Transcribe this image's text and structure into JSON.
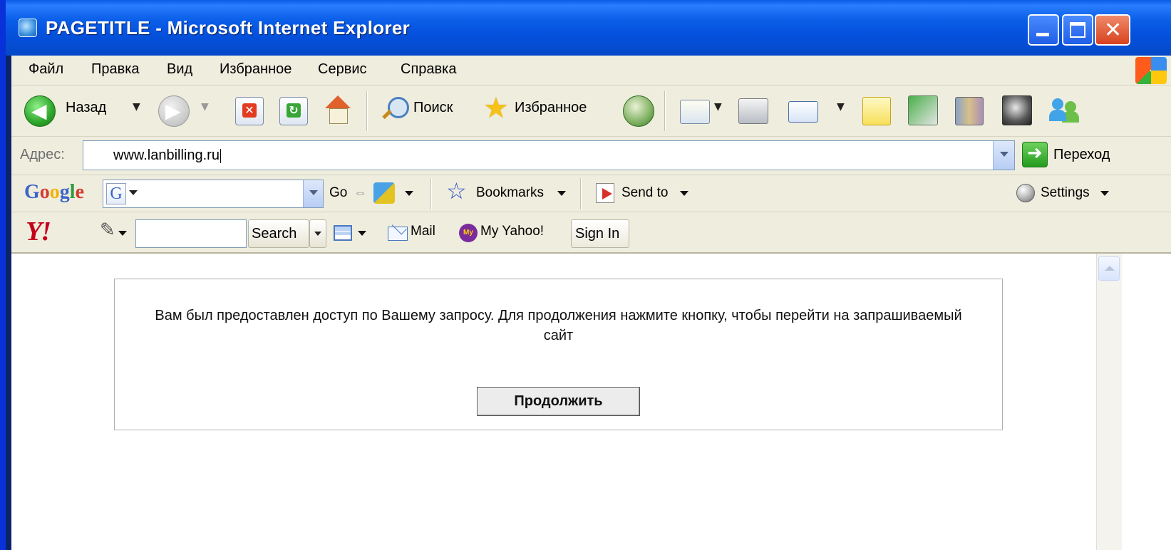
{
  "window": {
    "title": "PAGETITLE - Microsoft Internet Explorer"
  },
  "menu": {
    "items": [
      "Файл",
      "Правка",
      "Вид",
      "Избранное",
      "Сервис",
      "Справка"
    ]
  },
  "toolbar": {
    "back_label": "Назад",
    "search_label": "Поиск",
    "favorites_label": "Избранное"
  },
  "address": {
    "label": "Адрес:",
    "value": "www.lanbilling.ru",
    "go_label": "Переход"
  },
  "google_bar": {
    "logo": "Google",
    "go_label": "Go",
    "bookmarks_label": "Bookmarks",
    "sendto_label": "Send to",
    "settings_label": "Settings"
  },
  "yahoo_bar": {
    "logo": "Y!",
    "search_label": "Search",
    "mail_label": "Mail",
    "myyahoo_label": "My Yahoo!",
    "signin_label": "Sign In"
  },
  "page": {
    "message": "Вам был предоставлен доступ по Вашему запросу. Для продолжения нажмите кнопку, чтобы перейти на запрашиваемый сайт",
    "continue_label": "Продолжить"
  },
  "colors": {
    "titlebar": "#0b5fe8",
    "chrome": "#efedde",
    "google_blue": "#3a64c8",
    "yahoo_red": "#c4001a"
  },
  "icons": [
    "back-arrow-icon",
    "forward-arrow-icon",
    "stop-icon",
    "refresh-icon",
    "home-icon",
    "search-icon",
    "favorites-star-icon",
    "history-icon",
    "mail-icon",
    "print-icon",
    "edit-icon",
    "notes-icon",
    "icq-icon",
    "books-icon",
    "media-icon",
    "messenger-icon"
  ]
}
